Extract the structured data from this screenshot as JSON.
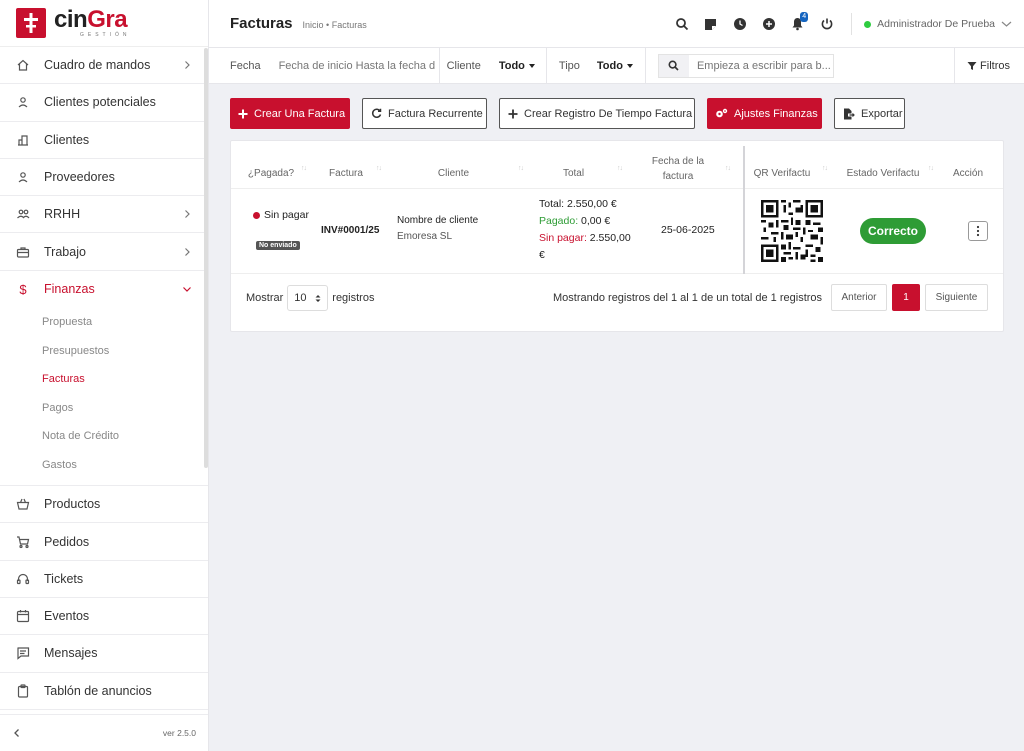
{
  "brand": {
    "name_a": "cin",
    "name_b": "Gra",
    "sub": "GESTIÓN"
  },
  "sidebar": {
    "items": [
      {
        "label": "Cuadro de mandos",
        "icon": "home-icon",
        "chevron": "right"
      },
      {
        "label": "Clientes potenciales",
        "icon": "user-icon",
        "chevron": ""
      },
      {
        "label": "Clientes",
        "icon": "building-icon",
        "chevron": ""
      },
      {
        "label": "Proveedores",
        "icon": "user-icon",
        "chevron": ""
      },
      {
        "label": "RRHH",
        "icon": "users-icon",
        "chevron": "right"
      },
      {
        "label": "Trabajo",
        "icon": "briefcase-icon",
        "chevron": "right"
      },
      {
        "label": "Finanzas",
        "icon": "dollar-icon",
        "chevron": "down"
      }
    ],
    "submenu": [
      "Propuesta",
      "Presupuestos",
      "Facturas",
      "Pagos",
      "Nota de Crédito",
      "Gastos"
    ],
    "items_bottom": [
      {
        "label": "Productos",
        "icon": "basket-icon"
      },
      {
        "label": "Pedidos",
        "icon": "cart-icon"
      },
      {
        "label": "Tickets",
        "icon": "headset-icon"
      },
      {
        "label": "Eventos",
        "icon": "calendar-icon"
      },
      {
        "label": "Mensajes",
        "icon": "message-icon"
      },
      {
        "label": "Tablón de anuncios",
        "icon": "clipboard-icon"
      }
    ],
    "version": "ver 2.5.0"
  },
  "header": {
    "title": "Facturas",
    "breadcrumb": "Inicio • Facturas",
    "notification_count": "4",
    "user": "Administrador De Prueba"
  },
  "filters": {
    "date_label": "Fecha",
    "date_range": "Fecha de inicio Hasta la fecha d",
    "client_label": "Cliente",
    "client_value": "Todo",
    "type_label": "Tipo",
    "type_value": "Todo",
    "search_placeholder": "Empieza a escribir para b...",
    "filters_button": "Filtros"
  },
  "actions": {
    "create": "Crear Una Factura",
    "recurring": "Factura Recurrente",
    "timelog": "Crear Registro De Tiempo Factura",
    "settings": "Ajustes Finanzas",
    "export": "Exportar"
  },
  "table": {
    "columns": [
      "¿Pagada?",
      "Factura",
      "Cliente",
      "Total",
      "Fecha de la factura",
      "QR Verifactu",
      "Estado Verifactu",
      "Acción"
    ],
    "rows": [
      {
        "paid": "Sin pagar",
        "sent": "No enviado",
        "invoice": "INV#0001/25",
        "client_name": "Nombre de cliente",
        "client_company": "Emoresa SL",
        "total_label": "Total:",
        "total": "2.550,00 €",
        "paid_label": "Pagado:",
        "paid_amount": "0,00 €",
        "unpaid_label": "Sin pagar:",
        "unpaid_amount": "2.550,00 €",
        "date": "25-06-2025",
        "verifactu_status": "Correcto"
      }
    ]
  },
  "footer": {
    "show_label": "Mostrar",
    "page_size": "10",
    "records_label": "registros",
    "info": "Mostrando registros del 1 al 1 de un total de 1 registros",
    "prev": "Anterior",
    "page": "1",
    "next": "Siguiente"
  },
  "colors": {
    "accent": "#c8102e",
    "success": "#2e9c35",
    "badge": "#1565c0"
  }
}
